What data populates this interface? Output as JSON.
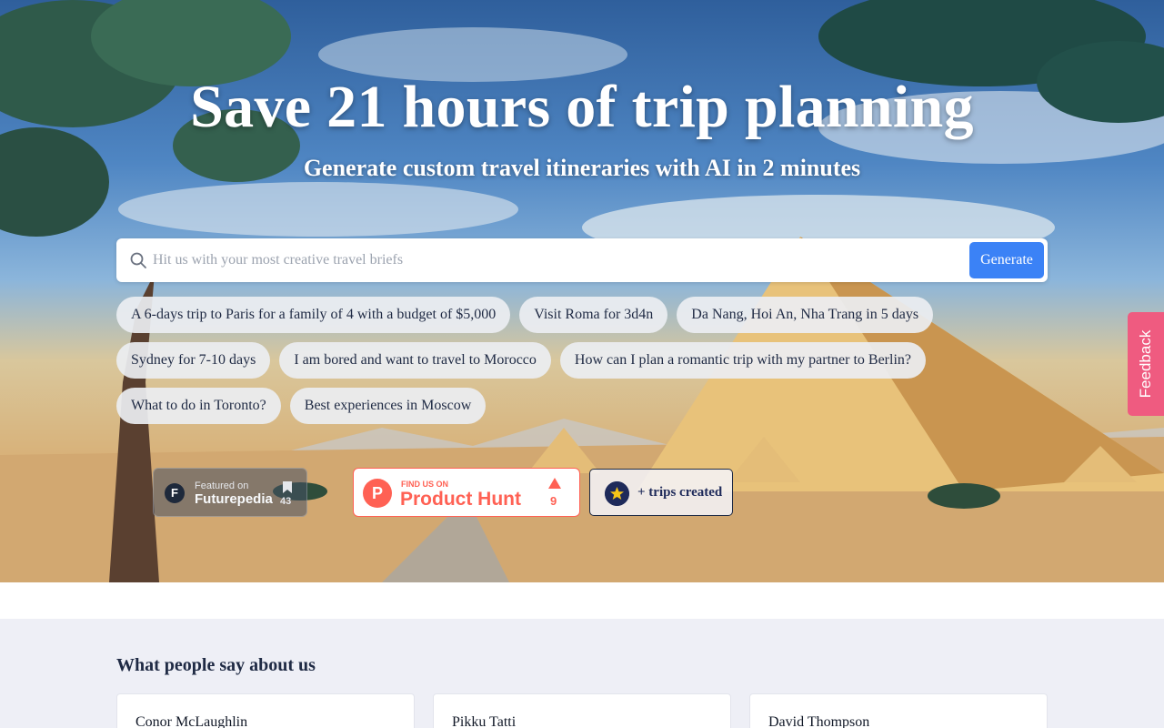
{
  "hero": {
    "title": "Save 21 hours of trip planning",
    "subtitle": "Generate custom travel itineraries with AI in 2 minutes"
  },
  "search": {
    "placeholder": "Hit us with your most creative travel briefs",
    "value": "",
    "button_label": "Generate"
  },
  "suggestions": [
    [
      "A 6-days trip to Paris for a family of 4 with a budget of $5,000",
      "Visit Roma for 3d4n",
      "Da Nang, Hoi An, Nha Trang in 5 days"
    ],
    [
      "Sydney for 7-10 days",
      "I am bored and want to travel to Morocco",
      "How can I plan a romantic trip with my partner to Berlin?"
    ],
    [
      "What to do in Toronto?",
      "Best experiences in Moscow"
    ]
  ],
  "badges": {
    "futurepedia": {
      "small": "Featured on",
      "big": "Futurepedia",
      "count": "43"
    },
    "product_hunt": {
      "small": "FIND US ON",
      "big": "Product Hunt",
      "count": "9",
      "color": "#ff6154"
    },
    "trips": {
      "label": "+ trips created"
    }
  },
  "feedback": {
    "label": "Feedback",
    "color": "#ef5b80"
  },
  "testimonials": {
    "title": "What people say about us",
    "names": [
      "Conor McLaughlin",
      "Pikku Tatti",
      "David Thompson"
    ]
  },
  "colors": {
    "accent": "#3b82f6",
    "navy": "#1f2a44"
  }
}
